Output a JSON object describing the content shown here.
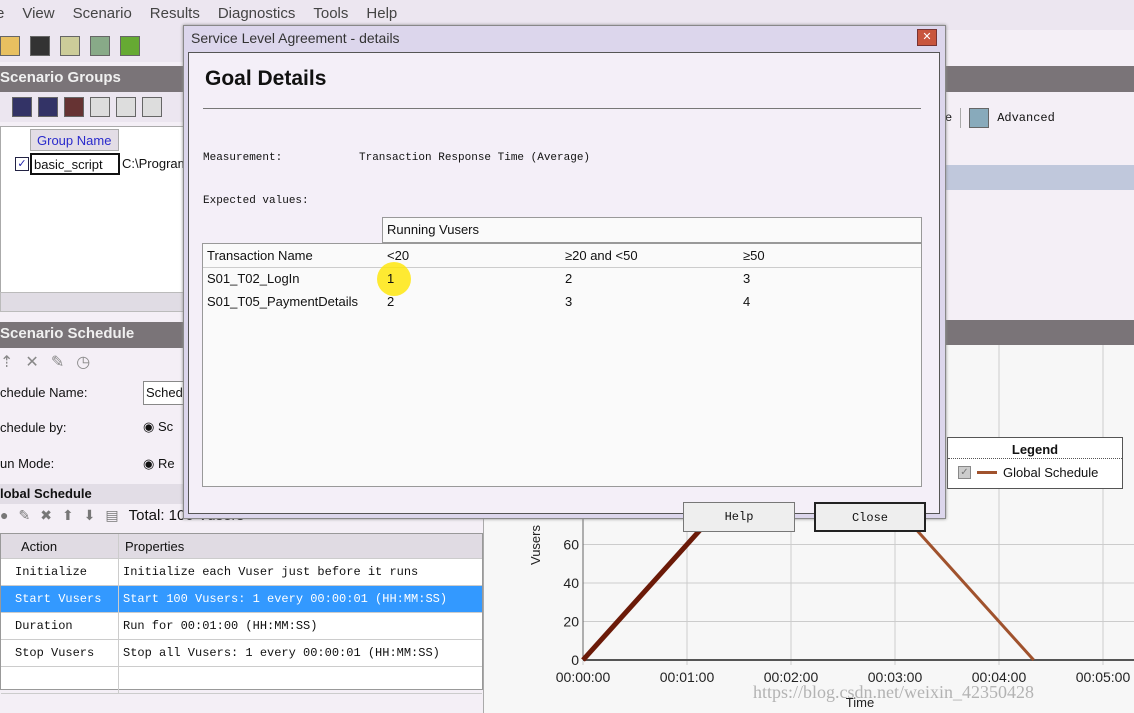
{
  "menu": [
    "e",
    "View",
    "Scenario",
    "Results",
    "Diagnostics",
    "Tools",
    "Help"
  ],
  "scenario_groups": {
    "title": "Scenario Groups",
    "columns": [
      "Group Name"
    ],
    "rows": [
      {
        "name": "basic_script",
        "path": "C:\\Program"
      }
    ]
  },
  "scenario_schedule": {
    "title": "Scenario Schedule",
    "schedule_name_label": "chedule Name:",
    "schedule_name_value": "Sched",
    "schedule_by_label": "chedule by:",
    "schedule_by_value": "Sc",
    "run_mode_label": "un Mode:",
    "run_mode_value": "Re"
  },
  "global_schedule": {
    "title": "lobal Schedule",
    "total": "Total: 100 Vusers",
    "columns": [
      "Action",
      "Properties"
    ],
    "rows": [
      {
        "action": "Initialize",
        "properties": "Initialize each Vuser just before it runs"
      },
      {
        "action": "Start  Vusers",
        "properties": "Start 100 Vusers: 1 every 00:00:01 (HH:MM:SS)",
        "selected": true
      },
      {
        "action": "Duration",
        "properties": "Run for 00:01:00 (HH:MM:SS)"
      },
      {
        "action": "Stop Vusers",
        "properties": "Stop all Vusers: 1 every 00:00:01 (HH:MM:SS)"
      }
    ]
  },
  "right_toolbar": {
    "partial": "e",
    "advanced": "Advanced"
  },
  "dialog": {
    "title": "Service Level Agreement - details",
    "heading": "Goal Details",
    "measurement_label": "Measurement:",
    "measurement_value": "Transaction Response Time (Average)",
    "expected_label": "Expected values:",
    "group_header": "Running Vusers",
    "columns": [
      "Transaction Name",
      "<20",
      "≥20 and <50",
      "≥50"
    ],
    "rows": [
      [
        "S01_T02_LogIn",
        "1",
        "2",
        "3"
      ],
      [
        "S01_T05_PaymentDetails",
        "2",
        "3",
        "4"
      ]
    ],
    "help": "Help",
    "close": "Close"
  },
  "chart_data": {
    "type": "line",
    "xlabel": "Time",
    "ylabel": "Vusers",
    "x_ticks": [
      "00:00:00",
      "00:01:00",
      "00:02:00",
      "00:03:00",
      "00:04:00",
      "00:05:00"
    ],
    "y_ticks": [
      "0",
      "20",
      "40",
      "60"
    ],
    "series": [
      {
        "name": "Global Schedule",
        "color": "#a0522d",
        "x": [
          "00:00:00",
          "00:01:40",
          "00:02:40",
          "00:04:20"
        ],
        "y": [
          0,
          100,
          100,
          0
        ]
      }
    ],
    "legend": {
      "title": "Legend",
      "position": "top-right"
    }
  },
  "watermark": "https://blog.csdn.net/weixin_42350428"
}
